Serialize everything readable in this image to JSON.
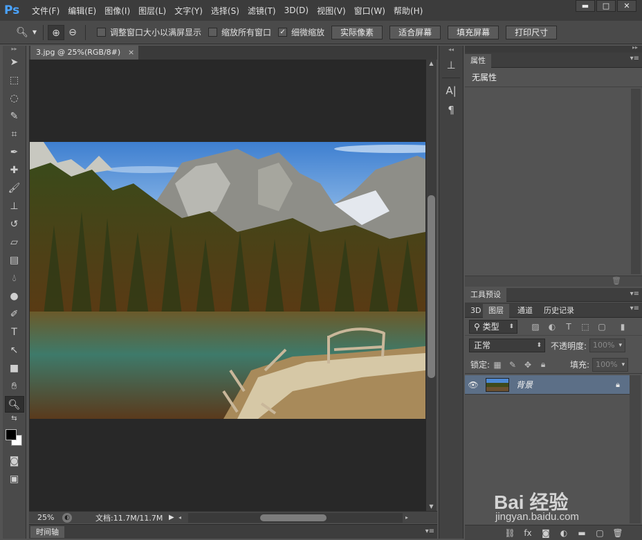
{
  "app": {
    "logo": "Ps"
  },
  "menu": [
    "文件(F)",
    "编辑(E)",
    "图像(I)",
    "图层(L)",
    "文字(Y)",
    "选择(S)",
    "滤镜(T)",
    "3D(D)",
    "视图(V)",
    "窗口(W)",
    "帮助(H)"
  ],
  "window_controls": {
    "minimize": "▬",
    "maximize": "□",
    "close": "✕"
  },
  "options": {
    "resize_windows": "调整窗口大小以满屏显示",
    "zoom_all_windows": "缩放所有窗口",
    "scrubby_zoom": "细微缩放",
    "scrubby_zoom_checked": true,
    "btn_actual_pixels": "实际像素",
    "btn_fit_screen": "适合屏幕",
    "btn_fill_screen": "填充屏幕",
    "btn_print_size": "打印尺寸"
  },
  "document": {
    "tab_title": "3.jpg @ 25%(RGB/8#)",
    "close": "×"
  },
  "status": {
    "zoom": "25%",
    "doc_size": "文档:11.7M/11.7M"
  },
  "timeline": {
    "tab": "时间轴"
  },
  "properties": {
    "tab": "属性",
    "content": "无属性"
  },
  "tool_presets": {
    "tab": "工具预设"
  },
  "layers_panel": {
    "tabs": [
      "3D",
      "图层",
      "通道",
      "历史记录"
    ],
    "filter_kind": "类型",
    "blend_mode": "正常",
    "opacity_label": "不透明度:",
    "opacity_value": "100%",
    "lock_label": "锁定:",
    "fill_label": "填充:",
    "fill_value": "100%",
    "layer_name": "背景"
  },
  "watermark": {
    "brand": "Bai 经验",
    "url": "jingyan.baidu.com"
  }
}
